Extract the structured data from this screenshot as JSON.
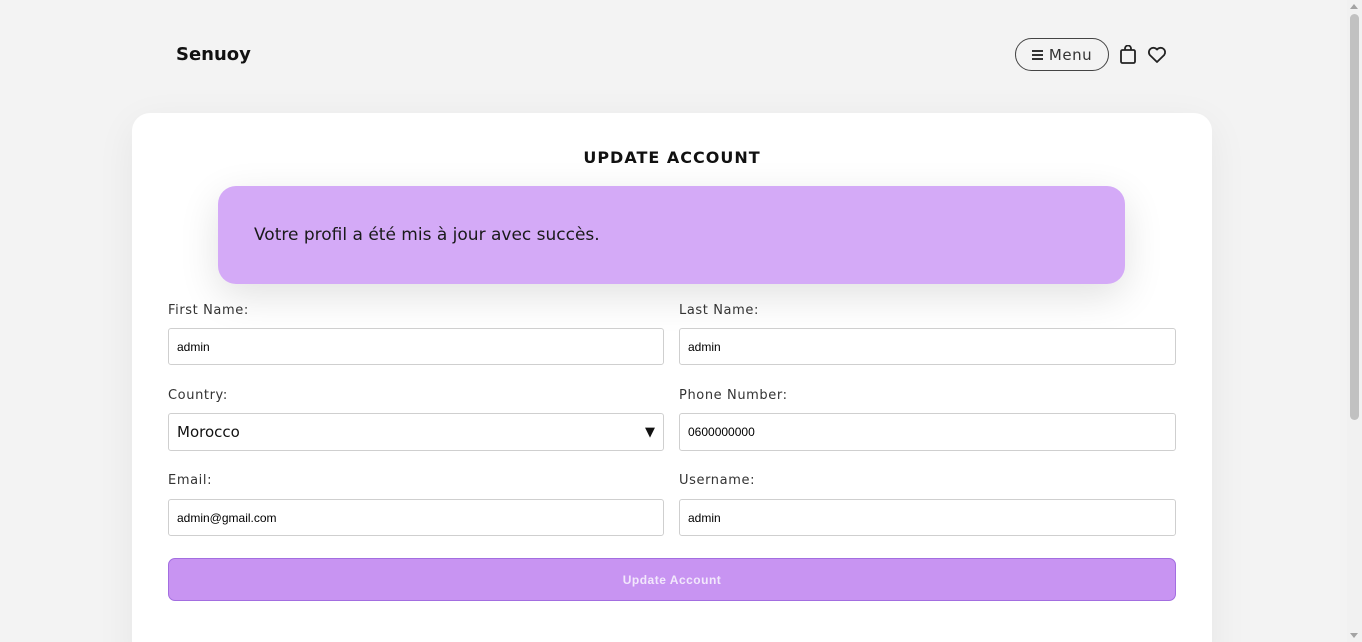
{
  "header": {
    "logo": "Senuoy",
    "menu_label": "Menu",
    "icons": [
      "bag-icon",
      "heart-icon"
    ]
  },
  "page": {
    "title": "UPDATE ACCOUNT",
    "alert_message": "Votre profil a été mis à jour avec succès."
  },
  "form": {
    "first_name": {
      "label": "First Name:",
      "value": "admin"
    },
    "last_name": {
      "label": "Last Name:",
      "value": "admin"
    },
    "country": {
      "label": "Country:",
      "value": "Morocco"
    },
    "phone": {
      "label": "Phone Number:",
      "value": "0600000000"
    },
    "email": {
      "label": "Email:",
      "value": "admin@gmail.com"
    },
    "username": {
      "label": "Username:",
      "value": "admin"
    },
    "submit_label": "Update Account"
  },
  "colors": {
    "alert_bg": "#d4aaf7",
    "button_bg": "#c894f2",
    "page_bg": "#f3f3f3"
  }
}
